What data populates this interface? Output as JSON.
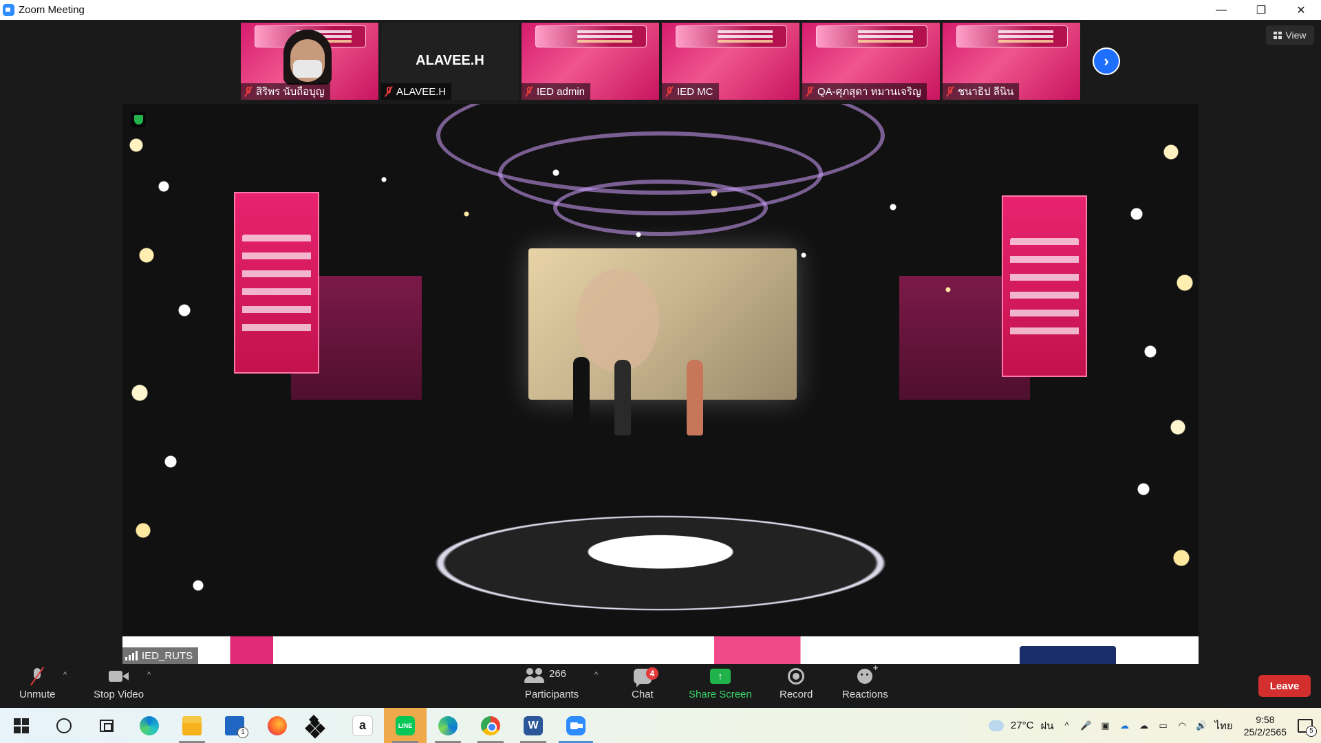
{
  "window": {
    "title": "Zoom Meeting",
    "minimize": "—",
    "restore": "❐",
    "close": "✕"
  },
  "gallery": {
    "tiles": [
      {
        "name": "สิริพร นับถือบุญ"
      },
      {
        "name": "ALAVEE.H",
        "display_name": "ALAVEE.H"
      },
      {
        "name": "IED admin"
      },
      {
        "name": "IED MC"
      },
      {
        "name": "QA-ศุภสุดา หมานเจริญ"
      },
      {
        "name": "ชนาธิป ลีนิน"
      }
    ],
    "next_arrow": "›",
    "view_label": "View"
  },
  "main_video": {
    "speaker_name": "IED_RUTS"
  },
  "toolbar": {
    "unmute": "Unmute",
    "stop_video": "Stop Video",
    "participants": "Participants",
    "participants_count": "266",
    "chat": "Chat",
    "chat_badge": "4",
    "share_screen": "Share Screen",
    "share_arrow": "↑",
    "record": "Record",
    "reactions": "Reactions",
    "leave": "Leave",
    "caret": "^"
  },
  "taskbar": {
    "weather": "27°C",
    "weather_desc": "ฝน",
    "language": "ไทย",
    "time": "9:58",
    "date": "25/2/2565",
    "amazon_glyph": "a",
    "line_glyph": "LINE",
    "word_glyph": "W",
    "tray_up": "^",
    "mic_glyph": "🎤",
    "volume_glyph": "🔊"
  },
  "colors": {
    "zoom_blue": "#2d8cff",
    "leave_red": "#d32f2f",
    "share_green": "#21b24b",
    "tile_pink": "#e62a78"
  }
}
